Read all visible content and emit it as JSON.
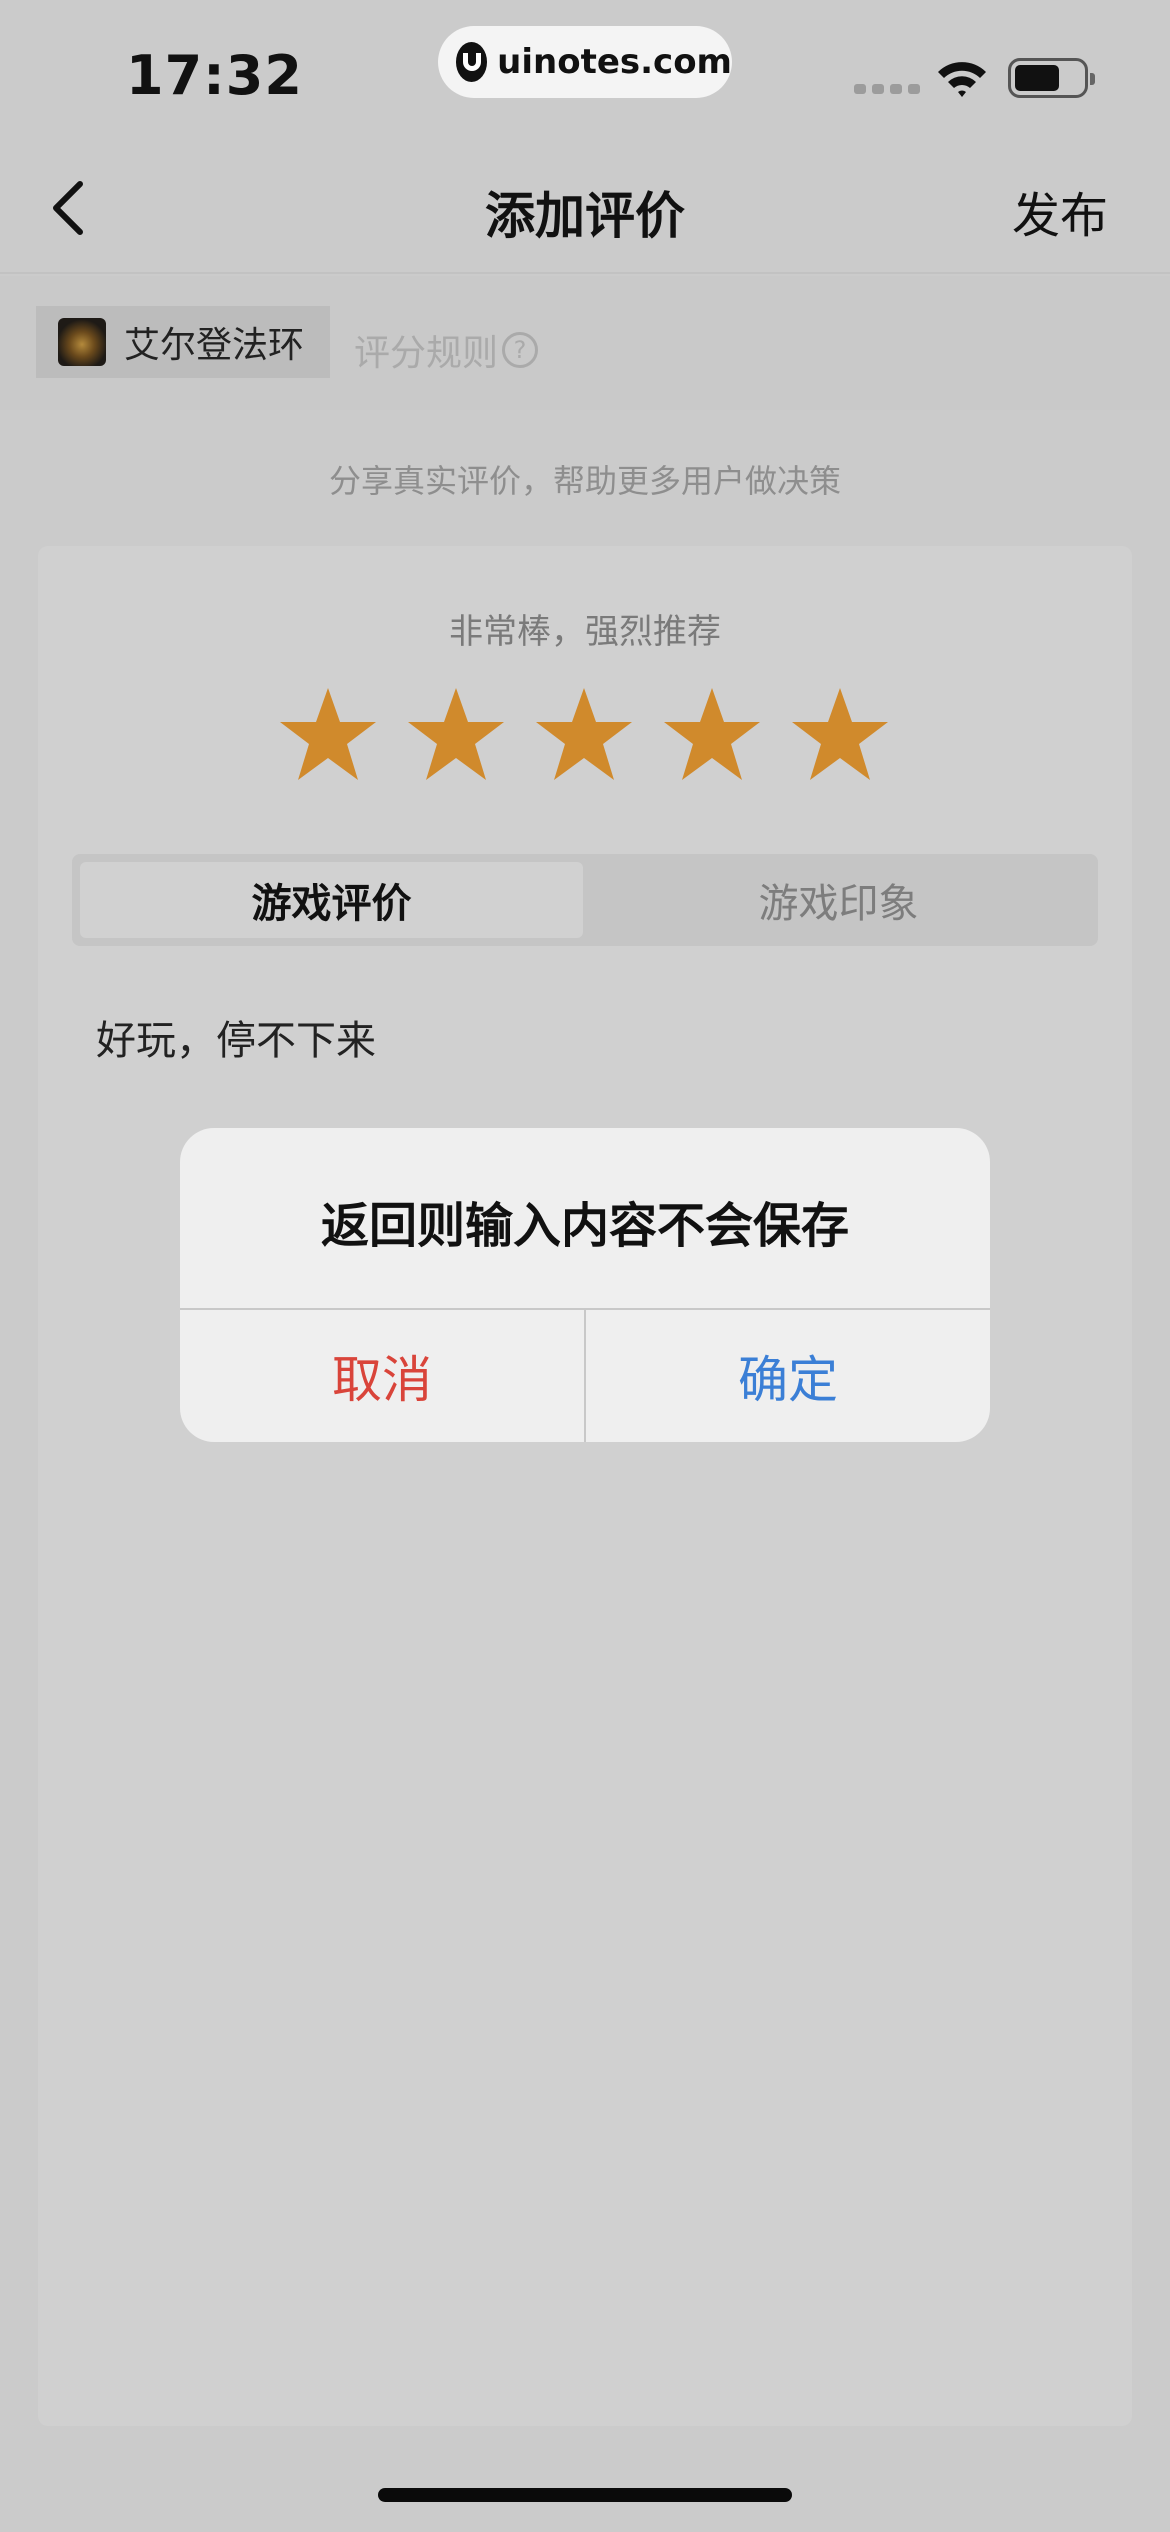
{
  "status_bar": {
    "time": "17:32",
    "url": "uinotes.com",
    "wifi_icon": "wifi-icon",
    "battery_icon": "battery-icon"
  },
  "nav": {
    "back_icon": "chevron-left-icon",
    "title": "添加评价",
    "publish_label": "发布"
  },
  "game": {
    "name": "艾尔登法环",
    "rules_label": "评分规则",
    "help_icon": "?"
  },
  "prompt": "分享真实评价，帮助更多用户做决策",
  "rating": {
    "label": "非常棒，强烈推荐",
    "stars": 5,
    "max": 5,
    "star_color": "#d08a2c"
  },
  "tabs": [
    {
      "label": "游戏评价",
      "active": true
    },
    {
      "label": "游戏印象",
      "active": false
    }
  ],
  "review": {
    "text": "好玩，停不下来"
  },
  "dialog": {
    "message": "返回则输入内容不会保存",
    "cancel_label": "取消",
    "confirm_label": "确定",
    "cancel_color": "#d9443a",
    "confirm_color": "#3b7fd6"
  }
}
